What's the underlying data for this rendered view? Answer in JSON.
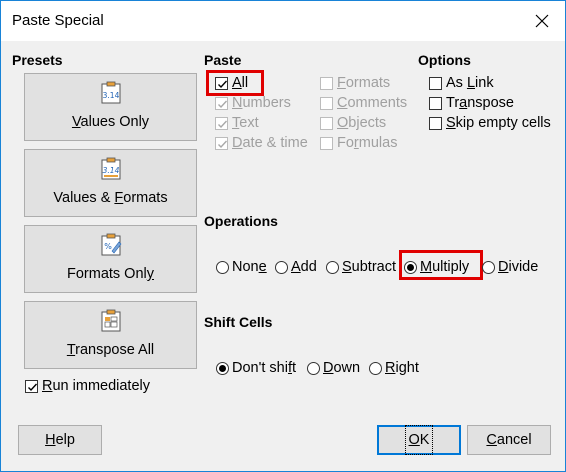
{
  "window": {
    "title": "Paste Special",
    "close_icon": "close-icon"
  },
  "presets": {
    "heading": "Presets",
    "buttons": [
      {
        "label": "Values Only",
        "mnemonic_index": 1,
        "icon": "clipboard-number-icon",
        "icon_text": "3.14"
      },
      {
        "label": "Values & Formats",
        "mnemonic_index": 9,
        "icon": "clipboard-number-format-icon",
        "icon_text": "3.14"
      },
      {
        "label": "Formats Only",
        "mnemonic_index": 11,
        "icon": "clipboard-format-icon",
        "icon_text": "%"
      },
      {
        "label": "Transpose All",
        "mnemonic_index": 0,
        "icon": "clipboard-transpose-icon",
        "icon_text": ""
      }
    ],
    "run_immediately": {
      "label": "Run immediately",
      "checked": true
    }
  },
  "paste": {
    "heading": "Paste",
    "items": [
      {
        "label": "All",
        "checked": true,
        "enabled": true
      },
      {
        "label": "Numbers",
        "checked": true,
        "enabled": false
      },
      {
        "label": "Text",
        "checked": true,
        "enabled": false
      },
      {
        "label": "Date & time",
        "checked": true,
        "enabled": false
      },
      {
        "label": "Formats",
        "checked": false,
        "enabled": false
      },
      {
        "label": "Comments",
        "checked": false,
        "enabled": false
      },
      {
        "label": "Objects",
        "checked": false,
        "enabled": false
      },
      {
        "label": "Formulas",
        "checked": false,
        "enabled": false
      }
    ]
  },
  "options": {
    "heading": "Options",
    "items": [
      {
        "label": "As Link",
        "checked": false
      },
      {
        "label": "Transpose",
        "checked": false
      },
      {
        "label": "Skip empty cells",
        "checked": false
      }
    ]
  },
  "operations": {
    "heading": "Operations",
    "items": [
      {
        "label": "None",
        "selected": false
      },
      {
        "label": "Add",
        "selected": false
      },
      {
        "label": "Subtract",
        "selected": false
      },
      {
        "label": "Multiply",
        "selected": true
      },
      {
        "label": "Divide",
        "selected": false
      }
    ]
  },
  "shift_cells": {
    "heading": "Shift Cells",
    "items": [
      {
        "label": "Don't shift",
        "selected": true
      },
      {
        "label": "Down",
        "selected": false
      },
      {
        "label": "Right",
        "selected": false
      }
    ]
  },
  "buttons": {
    "help": "Help",
    "ok": "OK",
    "cancel": "Cancel"
  },
  "colors": {
    "highlight": "#e00000",
    "accent": "#0078d7",
    "icon_orange": "#e8a13a"
  }
}
